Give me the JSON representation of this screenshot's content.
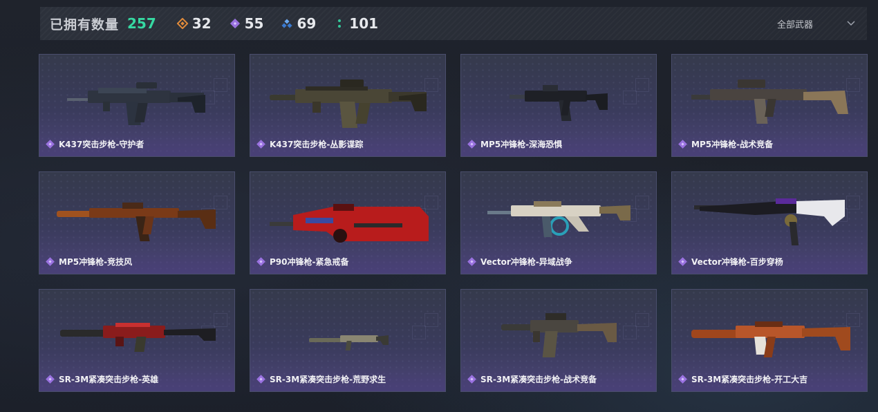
{
  "header": {
    "owned_label": "已拥有数量",
    "owned_count": "257",
    "rarities": [
      {
        "icon": "orange-diamond-icon",
        "color": "#e08a3a",
        "count": "32"
      },
      {
        "icon": "purple-diamond-icon",
        "color": "#9a72e0",
        "count": "55"
      },
      {
        "icon": "blue-diamonds-icon",
        "color": "#4a90e2",
        "count": "69"
      },
      {
        "icon": "green-dots-icon",
        "color": "#34c89a",
        "count": "101"
      }
    ],
    "filter_label": "全部武器"
  },
  "weapons": [
    {
      "name": "K437突击步枪-守护者"
    },
    {
      "name": "K437突击步枪-丛影谍踪"
    },
    {
      "name": "MP5冲锋枪-深海恐惧"
    },
    {
      "name": "MP5冲锋枪-战术竞备"
    },
    {
      "name": "MP5冲锋枪-竞技风"
    },
    {
      "name": "P90冲锋枪-紧急戒备"
    },
    {
      "name": "Vector冲锋枪-异域战争"
    },
    {
      "name": "Vector冲锋枪-百步穿杨"
    },
    {
      "name": "SR-3M紧凑突击步枪-英雄"
    },
    {
      "name": "SR-3M紧凑突击步枪-荒野求生"
    },
    {
      "name": "SR-3M紧凑突击步枪-战术竞备"
    },
    {
      "name": "SR-3M紧凑突击步枪-开工大吉"
    }
  ],
  "colors": {
    "accent_green": "#36d9a2",
    "card_border": "#4a4e6c",
    "rarity_purple": "#9a72e0"
  }
}
